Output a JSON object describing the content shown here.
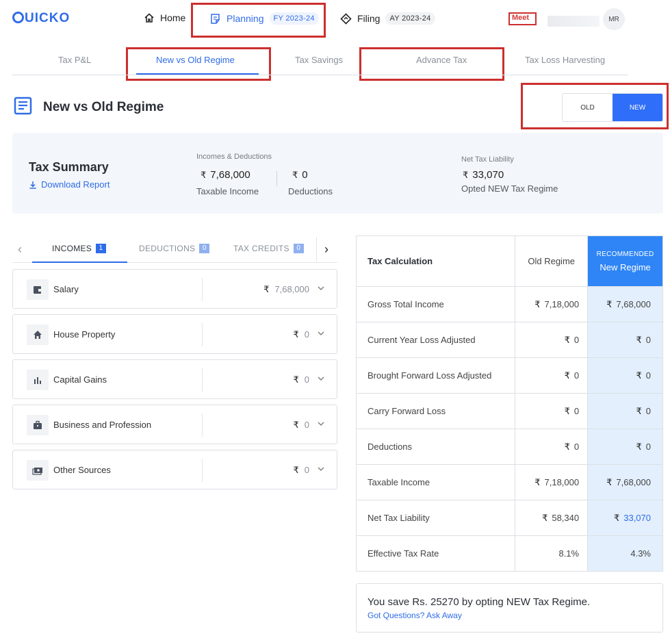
{
  "header": {
    "logo": "UICKO",
    "nav": {
      "home": "Home",
      "planning": "Planning",
      "planning_badge": "FY 2023-24",
      "filing": "Filing",
      "filing_badge": "AY 2023-24"
    },
    "meet": "Meet",
    "avatar": "MR"
  },
  "subtabs": [
    "Tax P&L",
    "New vs Old Regime",
    "Tax Savings",
    "Advance Tax",
    "Tax Loss Harvesting"
  ],
  "page": {
    "title": "New vs Old Regime",
    "toggle": {
      "old": "OLD",
      "new": "NEW"
    }
  },
  "summary": {
    "title": "Tax Summary",
    "download": "Download Report",
    "incomes_label": "Incomes & Deductions",
    "taxable_income_value": "7,68,000",
    "taxable_income_label": "Taxable Income",
    "deductions_value": "0",
    "deductions_label": "Deductions",
    "liability_label": "Net Tax Liability",
    "liability_value": "33,070",
    "liability_sub": "Opted NEW Tax Regime",
    "rupee": "₹"
  },
  "income_tabs": {
    "incomes": "INCOMES",
    "incomes_count": "1",
    "deductions": "DEDUCTIONS",
    "deductions_count": "0",
    "credits": "TAX CREDITS",
    "credits_count": "0"
  },
  "incomes": [
    {
      "name": "Salary",
      "amount": "7,68,000"
    },
    {
      "name": "House Property",
      "amount": "0"
    },
    {
      "name": "Capital Gains",
      "amount": "0"
    },
    {
      "name": "Business and Profession",
      "amount": "0"
    },
    {
      "name": "Other Sources",
      "amount": "0"
    }
  ],
  "tax_table": {
    "head": {
      "label": "Tax Calculation",
      "old": "Old Regime",
      "recommended": "RECOMMENDED",
      "new": "New Regime"
    },
    "rows": [
      {
        "label": "Gross Total Income",
        "old": "7,18,000",
        "new": "7,68,000"
      },
      {
        "label": "Current Year Loss Adjusted",
        "old": "0",
        "new": "0"
      },
      {
        "label": "Brought Forward Loss Adjusted",
        "old": "0",
        "new": "0"
      },
      {
        "label": "Carry Forward Loss",
        "old": "0",
        "new": "0"
      },
      {
        "label": "Deductions",
        "old": "0",
        "new": "0"
      },
      {
        "label": "Taxable Income",
        "old": "7,18,000",
        "new": "7,68,000"
      },
      {
        "label": "Net Tax Liability",
        "old": "58,340",
        "new": "33,070"
      },
      {
        "label": "Effective Tax Rate",
        "old": "8.1%",
        "new": "4.3%"
      }
    ]
  },
  "savings": {
    "message": "You save Rs. 25270 by opting NEW Tax Regime.",
    "link": "Got Questions? Ask Away"
  }
}
